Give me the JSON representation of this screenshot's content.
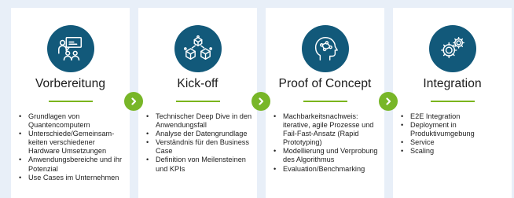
{
  "colors": {
    "background": "#e8eff8",
    "card": "#ffffff",
    "icon_circle": "#12597a",
    "accent_green": "#78b628",
    "rule_green": "#7ab51d"
  },
  "cards": [
    {
      "title": "Vorbereitung",
      "icon": "presenter-board-icon",
      "items": [
        "Grundlagen von Quantencomputern",
        "Unterschiede/Gemeinsam-keiten verschiedener Hardware Umsetzungen",
        "Anwendungsbereiche und ihr Potenzial",
        "Use Cases im Unternehmen"
      ]
    },
    {
      "title": "Kick-off",
      "icon": "cubes-network-icon",
      "items": [
        "Technischer Deep Dive in den Anwendungsfall",
        "Analyse der Datengrundlage",
        "Verständnis für den Business Case",
        "Definition von Meilensteinen und KPIs"
      ]
    },
    {
      "title": "Proof of Concept",
      "icon": "head-network-icon",
      "items": [
        "Machbarkeitsnachweis: iterative, agile Prozesse und Fail-Fast-Ansatz (Rapid Prototyping)",
        "Modellierung und Verprobung des Algorithmus",
        "Evaluation/Benchmarking"
      ]
    },
    {
      "title": "Integration",
      "icon": "gears-icon",
      "items": [
        "E2E Integration",
        "Deployment in Produktivumgebung",
        "Service",
        "Scaling"
      ]
    }
  ],
  "arrows": [
    "chevron-right-icon",
    "chevron-right-icon",
    "chevron-right-icon"
  ]
}
